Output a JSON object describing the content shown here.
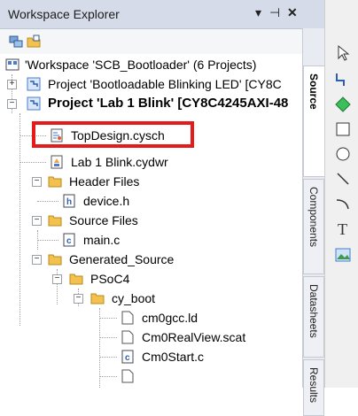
{
  "panel": {
    "title": "Workspace Explorer",
    "pin_glyph": "▾ ⊣",
    "close_glyph": "✕"
  },
  "tree": {
    "workspace": "'Workspace 'SCB_Bootloader' (6 Projects)",
    "project1": "Project  'Bootloadable Blinking LED' [CY8C",
    "project2": "Project 'Lab 1 Blink' [CY8C4245AXI-48",
    "topdesign": "TopDesign.cysch",
    "cydwr": "Lab 1 Blink.cydwr",
    "header_files": "Header Files",
    "device_h": "device.h",
    "source_files": "Source Files",
    "main_c": "main.c",
    "generated_source": "Generated_Source",
    "psoc4": "PSoC4",
    "cy_boot": "cy_boot",
    "cm0gcc": "cm0gcc.ld",
    "cm0realview": "Cm0RealView.scat",
    "cm0start": "Cm0Start.c"
  },
  "tabs": {
    "source": "Source",
    "components": "Components",
    "datasheets": "Datasheets",
    "results": "Results"
  },
  "colors": {
    "highlight": "#e51b1b",
    "folder": "#f2c14e",
    "project": "#4a7bd0"
  }
}
